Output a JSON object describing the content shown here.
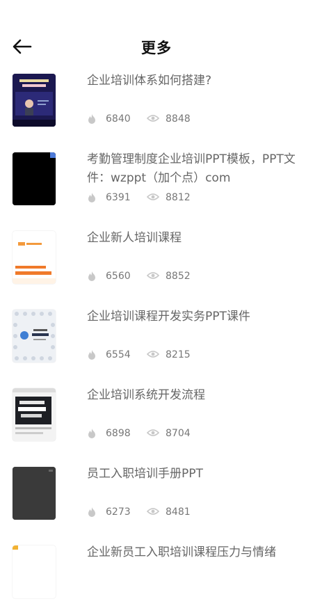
{
  "header": {
    "title": "更多",
    "back_icon": "arrow-left-icon"
  },
  "items": [
    {
      "title": "企业培训体系如何搭建?",
      "likes": "6840",
      "views": "8848",
      "thumb_style": "video-lecture"
    },
    {
      "title": "考勤管理制度企业培训PPT模板，PPT文件：wzppt（加个点）com",
      "likes": "6391",
      "views": "8812",
      "thumb_style": "black"
    },
    {
      "title": "企业新人培训课程",
      "likes": "6560",
      "views": "8852",
      "thumb_style": "orange-text"
    },
    {
      "title": "企业培训课程开发实务PPT课件",
      "likes": "6554",
      "views": "8215",
      "thumb_style": "blue-diagram"
    },
    {
      "title": "企业培训系统开发流程",
      "likes": "6898",
      "views": "8704",
      "thumb_style": "dark-screenshot"
    },
    {
      "title": "员工入职培训手册PPT",
      "likes": "6273",
      "views": "8481",
      "thumb_style": "dark-gray"
    },
    {
      "title": "企业新员工入职培训课程压力与情绪",
      "likes": "",
      "views": "",
      "thumb_style": "partial"
    }
  ],
  "icons": {
    "like": "flame-icon",
    "view": "eye-icon"
  },
  "colors": {
    "text_muted": "#777777",
    "title_text": "#666666",
    "header_text": "#111111",
    "icon_gray": "#c8c8c8"
  }
}
